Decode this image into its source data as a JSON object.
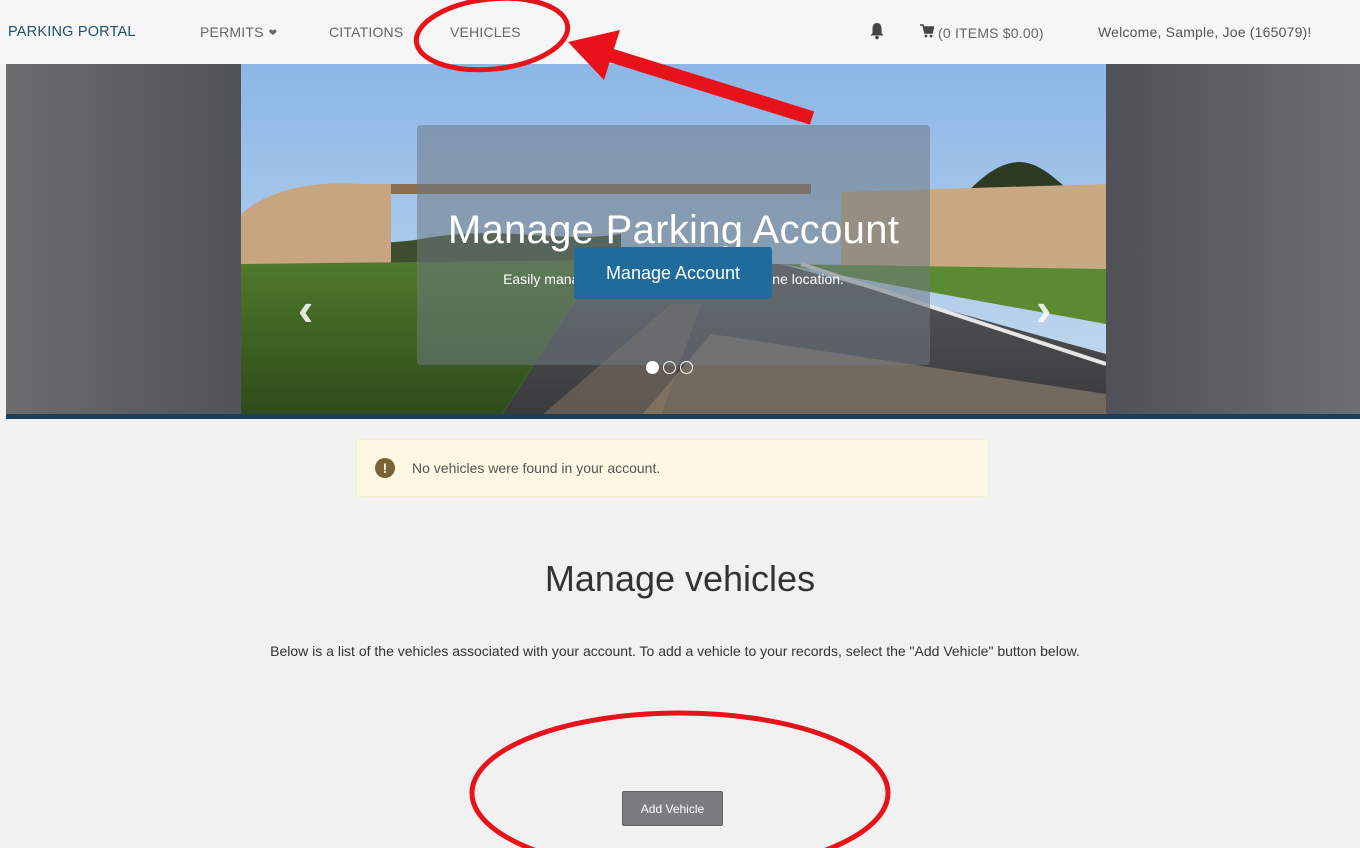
{
  "navbar": {
    "brand": "PARKING PORTAL",
    "permits": "PERMITS",
    "citations": "CITATIONS",
    "vehicles": "VEHICLES",
    "cart": "(0 ITEMS $0.00)",
    "welcome": "Welcome, Sample, Joe (165079)!",
    "icons": [
      "chevron-down-icon",
      "bell-icon",
      "cart-icon"
    ]
  },
  "hero": {
    "title": "Manage Parking Account",
    "subtitle": "Easily manage your parking account from one location.",
    "button": "Manage Account",
    "slide_count": 3,
    "active_slide": 1,
    "prev_icon": "chevron-left-icon",
    "next_icon": "chevron-right-icon"
  },
  "alert": {
    "icon": "exclamation-icon",
    "message": "No vehicles were found in your account."
  },
  "main": {
    "title": "Manage vehicles",
    "description": "Below is a list of the vehicles associated with your account. To add a vehicle to your records, select the \"Add Vehicle\" button below.",
    "add_button": "Add Vehicle"
  },
  "colors": {
    "nav_brand": "#1f4e6e",
    "primary_button": "#1e6b9c",
    "alert_bg": "#fcf8e3",
    "annotation": "#e8131a"
  }
}
